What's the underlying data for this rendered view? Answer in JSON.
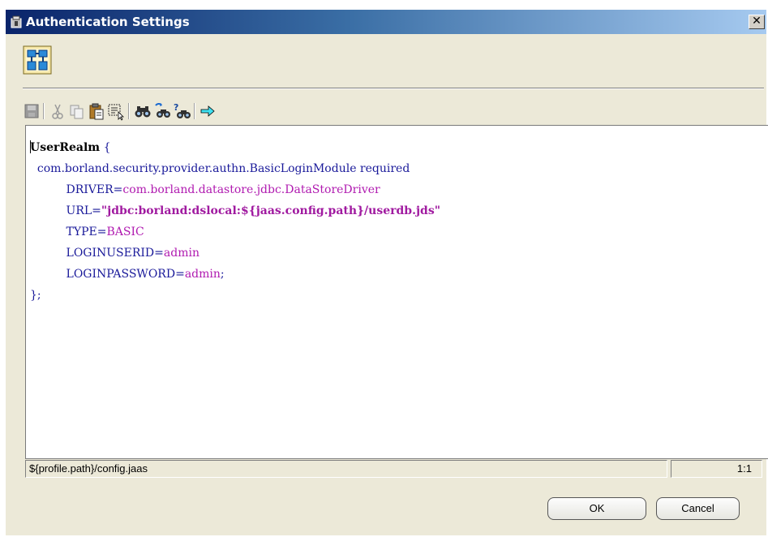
{
  "window": {
    "title": "Authentication Settings",
    "close_label": "✕"
  },
  "toolbar": {
    "buttons": [
      {
        "name": "save-icon",
        "enabled": false
      },
      {
        "name": "cut-icon",
        "enabled": false
      },
      {
        "name": "copy-icon",
        "enabled": false
      },
      {
        "name": "paste-icon",
        "enabled": true
      },
      {
        "name": "select-all-icon",
        "enabled": true
      },
      {
        "name": "find-icon",
        "enabled": true
      },
      {
        "name": "replace-icon",
        "enabled": true
      },
      {
        "name": "find-next-icon",
        "enabled": true
      },
      {
        "name": "goto-arrow-icon",
        "enabled": true
      }
    ]
  },
  "editor": {
    "lines": [
      {
        "indent": "",
        "parts": [
          {
            "t": "UserRealm",
            "s": "kw"
          },
          {
            "t": " {",
            "s": ""
          }
        ]
      },
      {
        "indent": "  ",
        "parts": [
          {
            "t": "com.borland.security.provider.authn.BasicLoginModule required",
            "s": ""
          }
        ]
      },
      {
        "indent": "          ",
        "parts": [
          {
            "t": "DRIVER=",
            "s": ""
          },
          {
            "t": "com.borland.datastore.jdbc.DataStoreDriver",
            "s": "mg"
          }
        ]
      },
      {
        "indent": "          ",
        "parts": [
          {
            "t": "URL=",
            "s": ""
          },
          {
            "t": "\"jdbc:borland:dslocal:${jaas.config.path}/userdb.jds\"",
            "s": "str"
          }
        ]
      },
      {
        "indent": "          ",
        "parts": [
          {
            "t": "TYPE=",
            "s": ""
          },
          {
            "t": "BASIC",
            "s": "mg"
          }
        ]
      },
      {
        "indent": "          ",
        "parts": [
          {
            "t": "LOGINUSERID=",
            "s": ""
          },
          {
            "t": "admin",
            "s": "mg"
          }
        ]
      },
      {
        "indent": "          ",
        "parts": [
          {
            "t": "LOGINPASSWORD=",
            "s": ""
          },
          {
            "t": "admin",
            "s": "mg"
          },
          {
            "t": ";",
            "s": ""
          }
        ]
      },
      {
        "indent": "",
        "parts": [
          {
            "t": "};",
            "s": ""
          }
        ]
      }
    ]
  },
  "status": {
    "path": "${profile.path}/config.jaas",
    "position": "1:1"
  },
  "buttons": {
    "ok": "OK",
    "cancel": "Cancel"
  },
  "colors": {
    "title_start": "#0a246a",
    "title_end": "#a6caf0",
    "dialog_bg": "#ece9d8",
    "keyword": "#000000",
    "text": "#1a1a9a",
    "value": "#b01ab0"
  }
}
